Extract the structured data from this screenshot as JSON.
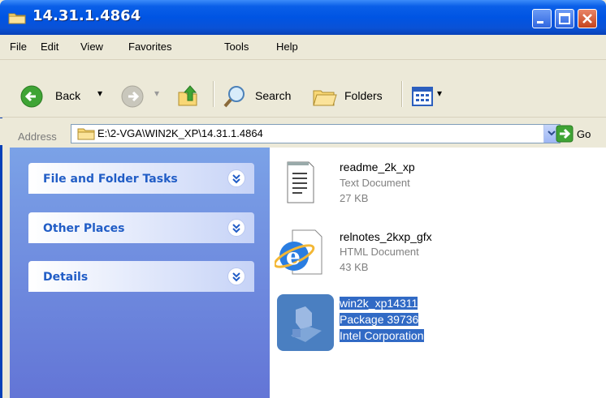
{
  "window": {
    "title": "14.31.1.4864"
  },
  "menu": [
    "File",
    "Edit",
    "View",
    "Favorites",
    "Tools",
    "Help"
  ],
  "toolbar": {
    "back": "Back",
    "search": "Search",
    "folders": "Folders"
  },
  "address": {
    "label": "Address",
    "value": "E:\\2-VGA\\WIN2K_XP\\14.31.1.4864",
    "go": "Go"
  },
  "tasks": [
    {
      "title": "File and Folder Tasks"
    },
    {
      "title": "Other Places"
    },
    {
      "title": "Details"
    }
  ],
  "files": [
    {
      "name": "readme_2k_xp",
      "type": "Text Document",
      "size": "27 KB",
      "icon": "text-document-icon"
    },
    {
      "name": "relnotes_2kxp_gfx",
      "type": "HTML Document",
      "size": "43 KB",
      "icon": "html-document-icon"
    },
    {
      "name": "win2k_xp14311",
      "type": "Package 39736",
      "size": "Intel Corporation",
      "icon": "package-icon"
    }
  ],
  "colors": {
    "titlebar": "#0054E3",
    "taskpane": "#6375D6",
    "selection": "#316AC5"
  }
}
